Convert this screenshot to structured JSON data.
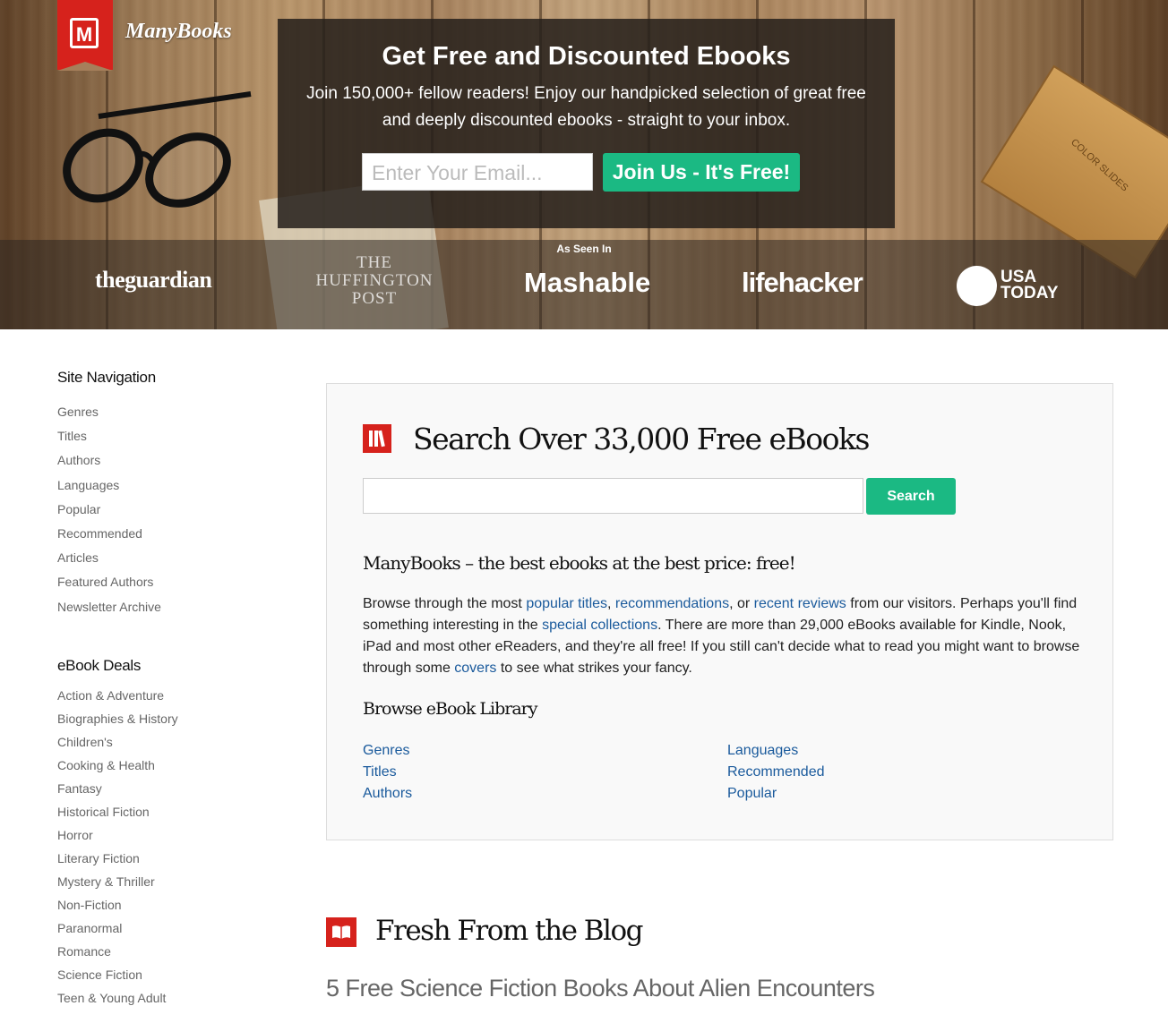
{
  "brand": {
    "name": "ManyBooks",
    "logo_letter": "M"
  },
  "signup": {
    "title": "Get Free and Discounted Ebooks",
    "text": "Join 150,000+ fellow readers! Enjoy our handpicked selection of great free and deeply discounted ebooks - straight to your inbox.",
    "email_placeholder": "Enter Your Email...",
    "button": "Join Us - It's Free!"
  },
  "press": {
    "label": "As Seen In",
    "logos": [
      "theguardian",
      "THE HUFFINGTON POST",
      "Mashable",
      "lifehacker",
      "USA TODAY"
    ]
  },
  "decor": {
    "slides_label": "COLOR SLIDES"
  },
  "sidebar": {
    "nav_title": "Site Navigation",
    "nav_items": [
      "Genres",
      "Titles",
      "Authors",
      "Languages",
      "Popular",
      "Recommended",
      "Articles",
      "Featured Authors",
      "Newsletter Archive"
    ],
    "deals_title": "eBook Deals",
    "deal_items": [
      "Action & Adventure",
      "Biographies & History",
      "Children's",
      "Cooking & Health",
      "Fantasy",
      "Historical Fiction",
      "Horror",
      "Literary Fiction",
      "Mystery & Thriller",
      "Non-Fiction",
      "Paranormal",
      "Romance",
      "Science Fiction",
      "Teen & Young Adult"
    ]
  },
  "search": {
    "title": "Search Over 33,000 Free eBooks",
    "input_value": "",
    "button": "Search"
  },
  "intro": {
    "tagline": "ManyBooks – the best ebooks at the best price: free!",
    "t1": "Browse through the most ",
    "l1": "popular titles",
    "t2": ", ",
    "l2": "recommendations",
    "t3": ", or ",
    "l3": "recent reviews",
    "t4": " from our visitors. Perhaps you'll find something interesting in the ",
    "l4": "special collections",
    "t5": ". There are more than 29,000 eBooks available for Kindle, Nook, iPad and most other eReaders, and they're all free! If you still can't decide what to read you might want to browse through some ",
    "l5": "covers",
    "t6": " to see what strikes your fancy."
  },
  "library": {
    "title": "Browse eBook Library",
    "left": [
      "Genres",
      "Titles",
      "Authors"
    ],
    "right": [
      "Languages",
      "Recommended",
      "Popular"
    ]
  },
  "blog": {
    "title": "Fresh From the Blog",
    "post_title": "5 Free Science Fiction Books About Alien Encounters"
  },
  "colors": {
    "accent": "#d6221c",
    "button": "#1bb983",
    "link": "#1a5a9c"
  }
}
